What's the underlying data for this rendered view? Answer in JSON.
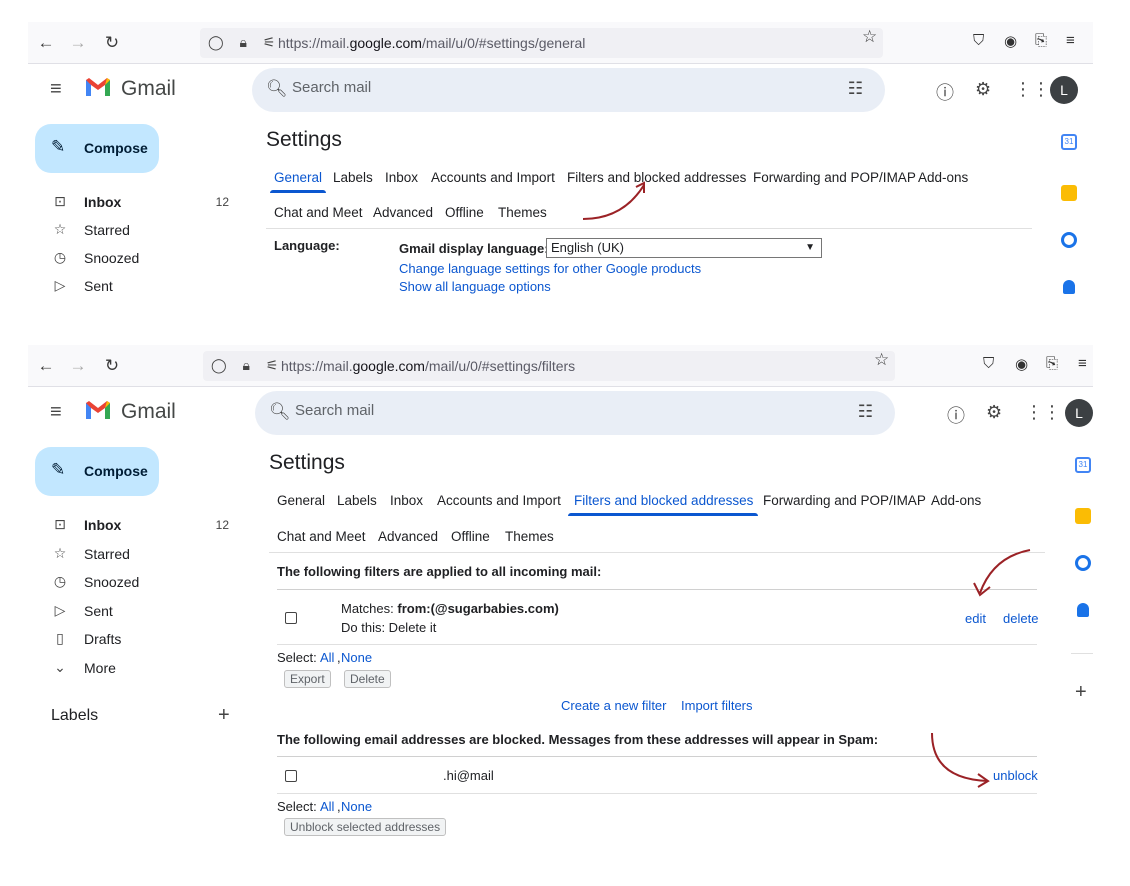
{
  "browser": {
    "url_prefix": "https://mail.",
    "url_domain": "google.com",
    "url_top_path": "/mail/u/0/#settings/general",
    "url_bottom_path": "/mail/u/0/#settings/filters"
  },
  "app": {
    "name": "Gmail",
    "search_placeholder": "Search mail",
    "avatar_letter": "L"
  },
  "nav": {
    "compose": "Compose",
    "items": [
      {
        "label": "Inbox",
        "count": "12"
      },
      {
        "label": "Starred"
      },
      {
        "label": "Snoozed"
      },
      {
        "label": "Sent"
      },
      {
        "label": "Drafts"
      },
      {
        "label": "More"
      }
    ],
    "labels_heading": "Labels"
  },
  "settings": {
    "title": "Settings",
    "tabs_row1": [
      "General",
      "Labels",
      "Inbox",
      "Accounts and Import",
      "Filters and blocked addresses",
      "Forwarding and POP/IMAP",
      "Add-ons"
    ],
    "tabs_row2": [
      "Chat and Meet",
      "Advanced",
      "Offline",
      "Themes"
    ],
    "active_top": "General",
    "active_bottom": "Filters and blocked addresses"
  },
  "language": {
    "label": "Language:",
    "display_label": "Gmail display language:",
    "selected": "English (UK)",
    "link1": "Change language settings for other Google products",
    "link2": "Show all language options"
  },
  "filters": {
    "heading": "The following filters are applied to all incoming mail:",
    "matches_label": "Matches: ",
    "matches_value": "from:(@sugarbabies.com)",
    "action": "Do this: Delete it",
    "edit": "edit",
    "delete": "delete",
    "select_label": "Select: ",
    "select_all": "All",
    "select_none": "None",
    "export_btn": "Export",
    "delete_btn": "Delete",
    "create_filter": "Create a new filter",
    "import_filters": "Import filters"
  },
  "blocked": {
    "heading": "The following email addresses are blocked. Messages from these addresses will appear in Spam:",
    "address": ".hi@mail",
    "unblock": "unblock",
    "select_label": "Select: ",
    "select_all": "All",
    "select_none": "None",
    "unblock_selected": "Unblock selected addresses"
  },
  "colors": {
    "accent": "#0b57d0",
    "compose_bg": "#c2e7ff",
    "arrow": "#9b2226"
  }
}
